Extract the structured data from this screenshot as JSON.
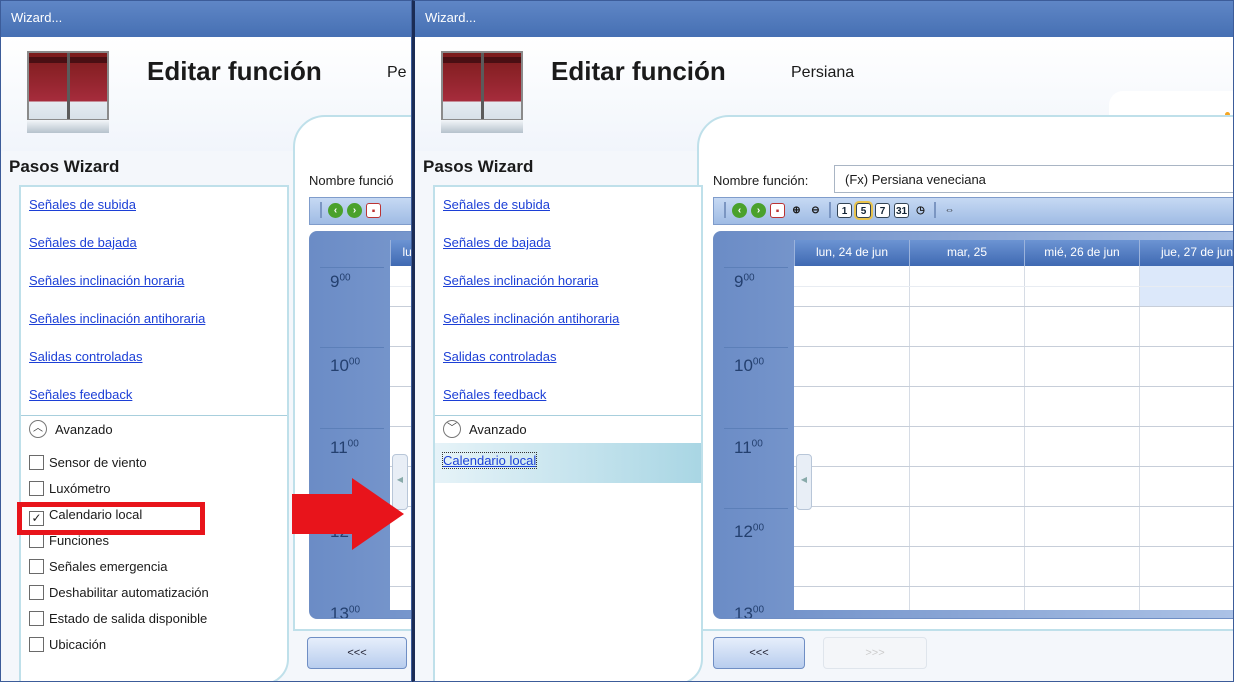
{
  "window_title": "Wizard...",
  "header": {
    "title": "Editar función",
    "subtitle": "Persiana",
    "subtitle_clipped": "Pe"
  },
  "steps": {
    "title": "Pasos Wizard",
    "items": [
      "Señales de subida",
      "Señales de bajada",
      "Señales inclinación horaria",
      "Señales inclinación antihoraria",
      "Salidas controladas",
      "Señales feedback"
    ],
    "advanced_label": "Avanzado",
    "advanced_expanded_icon": "chevron-up-icon",
    "advanced_collapsed_icon": "chevron-down-icon",
    "checkboxes": [
      {
        "label": "Sensor de viento",
        "checked": false
      },
      {
        "label": "Luxómetro",
        "checked": false
      },
      {
        "label": "Calendario local",
        "checked": true
      },
      {
        "label": "Funciones",
        "checked": false
      },
      {
        "label": "Señales emergencia",
        "checked": false
      },
      {
        "label": "Deshabilitar automatización",
        "checked": false
      },
      {
        "label": "Estado de salida disponible",
        "checked": false
      },
      {
        "label": "Ubicación",
        "checked": false
      }
    ],
    "added_step": "Calendario local"
  },
  "function": {
    "label": "Nombre función:",
    "label_clipped": "Nombre funció",
    "value": "(Fx) Persiana veneciana"
  },
  "toolbar": {
    "icons": [
      "back-icon",
      "forward-icon",
      "calendar-icon",
      "zoom-in-icon",
      "zoom-out-icon",
      "day-view-icon",
      "workweek-view-icon",
      "week-view-icon",
      "month-view-icon",
      "timeline-icon",
      "fit-icon"
    ]
  },
  "calendar": {
    "days": [
      "lun, 24 de jun",
      "mar, 25",
      "mié, 26 de jun",
      "jue, 27 de jun"
    ],
    "day_clipped": "lun",
    "hours": [
      {
        "h": "9",
        "m": "00"
      },
      {
        "h": "10",
        "m": "00"
      },
      {
        "h": "11",
        "m": "00"
      },
      {
        "h": "12",
        "m": "00"
      },
      {
        "h": "13",
        "m": "00"
      }
    ]
  },
  "buttons": {
    "back": "<<<",
    "next": ">>>"
  },
  "colors": {
    "highlight": "#e8141b",
    "arrow": "#e8141b",
    "title_bar": "#5f86c6"
  }
}
